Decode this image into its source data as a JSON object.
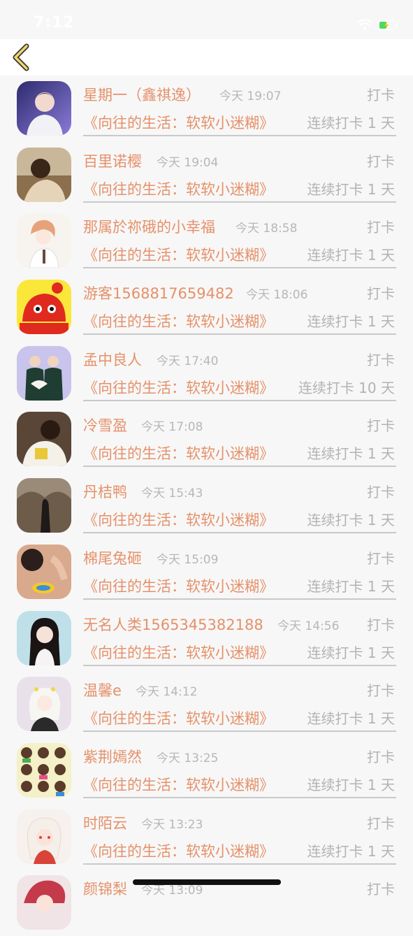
{
  "status_bar": {
    "time": "7:12"
  },
  "nav": {
    "back_icon": "chevron-left-icon"
  },
  "colors": {
    "accent": "#e5916a",
    "muted": "#b3b3b3",
    "back": "#f1d66a"
  },
  "entries": [
    {
      "name": "星期一（鑫祺逸）",
      "time": "今天 19:07",
      "action": "打卡",
      "book": "《向往的生活：软软小迷糊》",
      "streak": "连续打卡 1 天"
    },
    {
      "name": "百里诺樱",
      "time": "今天 19:04",
      "action": "打卡",
      "book": "《向往的生活：软软小迷糊》",
      "streak": "连续打卡 1 天"
    },
    {
      "name": "那属於祢硪的小幸福",
      "time": "今天 18:58",
      "action": "打卡",
      "book": "《向往的生活：软软小迷糊》",
      "streak": "连续打卡 1 天"
    },
    {
      "name": "游客1568817659482",
      "time": "今天 18:06",
      "action": "打卡",
      "book": "《向往的生活：软软小迷糊》",
      "streak": "连续打卡 1 天"
    },
    {
      "name": "孟中良人",
      "time": "今天 17:40",
      "action": "打卡",
      "book": "《向往的生活：软软小迷糊》",
      "streak": "连续打卡 10 天"
    },
    {
      "name": "冷雪盈",
      "time": "今天 17:08",
      "action": "打卡",
      "book": "《向往的生活：软软小迷糊》",
      "streak": "连续打卡 1 天"
    },
    {
      "name": "丹桔鸭",
      "time": "今天 15:43",
      "action": "打卡",
      "book": "《向往的生活：软软小迷糊》",
      "streak": "连续打卡 1 天"
    },
    {
      "name": "棉尾兔砸",
      "time": "今天 15:09",
      "action": "打卡",
      "book": "《向往的生活：软软小迷糊》",
      "streak": "连续打卡 1 天"
    },
    {
      "name": "无名人类1565345382188",
      "time": "今天 14:56",
      "action": "打卡",
      "book": "《向往的生活：软软小迷糊》",
      "streak": "连续打卡 1 天"
    },
    {
      "name": "温馨e",
      "time": "今天 14:12",
      "action": "打卡",
      "book": "《向往的生活：软软小迷糊》",
      "streak": "连续打卡 1 天"
    },
    {
      "name": "紫荆嫣然",
      "time": "今天 13:25",
      "action": "打卡",
      "book": "《向往的生活：软软小迷糊》",
      "streak": "连续打卡 1 天"
    },
    {
      "name": "时陌云",
      "time": "今天 13:23",
      "action": "打卡",
      "book": "《向往的生活：软软小迷糊》",
      "streak": "连续打卡 1 天"
    },
    {
      "name": "颜锦梨",
      "time": "今天 13:09",
      "action": "打卡",
      "book": "",
      "streak": ""
    }
  ]
}
